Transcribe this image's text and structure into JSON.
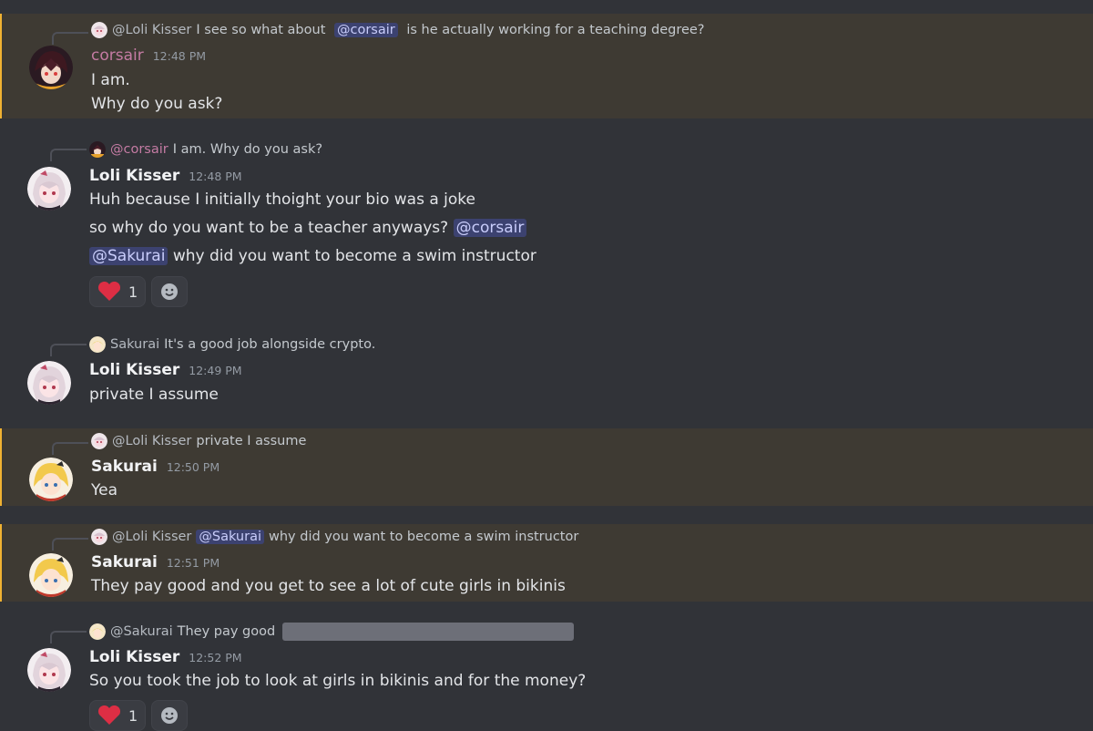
{
  "messages": [
    {
      "reply": {
        "name": "@Loli Kisser",
        "pre": "I see so what about ",
        "mention": "@corsair",
        "post": " is he actually working for a teaching degree?"
      },
      "author": "corsair",
      "time": "12:48 PM",
      "lines": [
        "I am.",
        "Why do you ask?"
      ]
    },
    {
      "reply": {
        "name": "@corsair",
        "text": "I am. Why do you ask?"
      },
      "author": "Loli Kisser",
      "time": "12:48 PM",
      "lines": [
        "Huh because I initially thoight your bio was a joke",
        "so why do you want to be a teacher anyways? ",
        "why did you want to become a swim instructor"
      ],
      "mentions": [
        "@corsair",
        "@Sakurai"
      ],
      "reaction": {
        "emoji": "heart",
        "count": "1"
      }
    },
    {
      "reply": {
        "name": "Sakurai",
        "text": "It's a good job alongside crypto."
      },
      "author": "Loli Kisser",
      "time": "12:49 PM",
      "lines": [
        "private I assume"
      ]
    },
    {
      "reply": {
        "name": "@Loli Kisser",
        "text": "private I assume"
      },
      "author": "Sakurai",
      "time": "12:50 PM",
      "lines": [
        "Yea"
      ]
    },
    {
      "reply": {
        "name": "@Loli Kisser",
        "mention": "@Sakurai",
        "text": "why did you want to become a swim instructor"
      },
      "author": "Sakurai",
      "time": "12:51 PM",
      "lines": [
        "They pay good and you get to see a lot of cute girls in bikinis"
      ]
    },
    {
      "reply": {
        "name": "@Sakurai",
        "text": "They pay good"
      },
      "author": "Loli Kisser",
      "time": "12:52 PM",
      "lines": [
        "So you took the job to look at girls in bikinis and for the money?"
      ],
      "reaction": {
        "emoji": "heart",
        "count": "1"
      }
    }
  ],
  "colors": {
    "highlight_bg": "#3e3a33",
    "highlight_bar": "#f0b232",
    "mention_bg": "#3c4270",
    "corsair_name": "#c47ba3"
  }
}
